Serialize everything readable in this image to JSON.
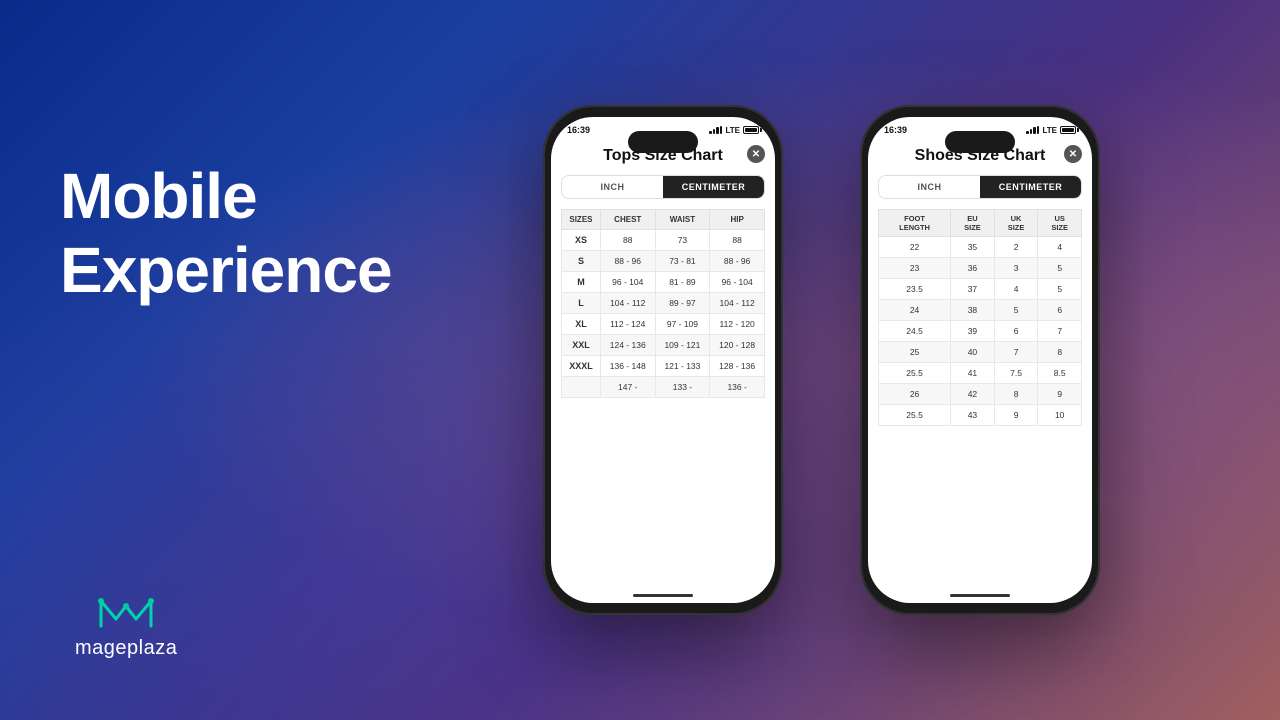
{
  "background": {
    "gradient": "blue-purple-pink"
  },
  "left_section": {
    "headline_line1": "Mobile",
    "headline_line2": "Experience"
  },
  "logo": {
    "name": "mageplaza"
  },
  "phone1": {
    "status_bar": {
      "time": "16:39",
      "signal": "LTE",
      "battery": "full"
    },
    "title": "Tops Size Chart",
    "toggle": {
      "option1": "INCH",
      "option2": "CENTIMETER",
      "active": "CENTIMETER"
    },
    "table": {
      "headers": [
        "SIZES",
        "CHEST",
        "WAIST",
        "HIP"
      ],
      "rows": [
        [
          "XS",
          "88",
          "73",
          "88"
        ],
        [
          "S",
          "88 - 96",
          "73 - 81",
          "88 - 96"
        ],
        [
          "M",
          "96 - 104",
          "81 - 89",
          "96 - 104"
        ],
        [
          "L",
          "104 - 112",
          "89 - 97",
          "104 - 112"
        ],
        [
          "XL",
          "112 - 124",
          "97 - 109",
          "112 - 120"
        ],
        [
          "XXL",
          "124 - 136",
          "109 - 121",
          "120 - 128"
        ],
        [
          "XXXL",
          "136 - 148",
          "121 - 133",
          "128 - 136"
        ],
        [
          "",
          "147 -",
          "133 -",
          "136 -"
        ]
      ]
    }
  },
  "phone2": {
    "status_bar": {
      "time": "16:39",
      "signal": "LTE",
      "battery": "full"
    },
    "title": "Shoes Size Chart",
    "toggle": {
      "option1": "INCH",
      "option2": "CENTIMETER",
      "active": "CENTIMETER"
    },
    "table": {
      "headers": [
        "FOOT LENGTH",
        "EU SIZE",
        "UK SIZE",
        "US SIZE"
      ],
      "rows": [
        [
          "22",
          "35",
          "2",
          "4"
        ],
        [
          "23",
          "36",
          "3",
          "5"
        ],
        [
          "23.5",
          "37",
          "4",
          "5"
        ],
        [
          "24",
          "38",
          "5",
          "6"
        ],
        [
          "24.5",
          "39",
          "6",
          "7"
        ],
        [
          "25",
          "40",
          "7",
          "8"
        ],
        [
          "25.5",
          "41",
          "7.5",
          "8.5"
        ],
        [
          "26",
          "42",
          "8",
          "9"
        ],
        [
          "25.5",
          "43",
          "9",
          "10"
        ]
      ]
    }
  }
}
